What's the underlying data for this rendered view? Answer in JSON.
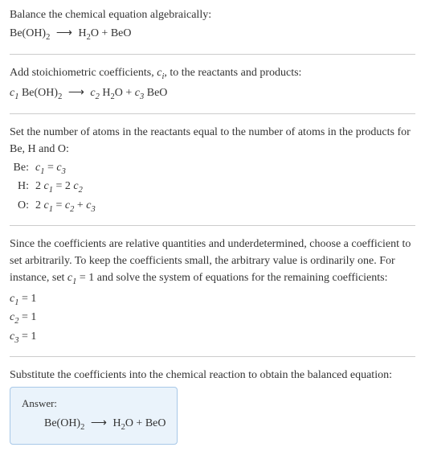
{
  "intro": {
    "line1": "Balance the chemical equation algebraically:",
    "reaction_lhs": "Be(OH)",
    "reaction_lhs_sub": "2",
    "arrow": "⟶",
    "reaction_rhs_1": "H",
    "reaction_rhs_1_sub": "2",
    "reaction_rhs_1_suffix": "O + BeO"
  },
  "stoich": {
    "text_before": "Add stoichiometric coefficients, ",
    "ci": "c",
    "ci_sub": "i",
    "text_after": ", to the reactants and products:",
    "c1": "c",
    "c1_sub": "1",
    "sp1": " Be(OH)",
    "sp1_sub": "2",
    "arrow": "⟶",
    "c2": "c",
    "c2_sub": "2",
    "sp2": " H",
    "sp2_sub": "2",
    "sp2_suffix": "O + ",
    "c3": "c",
    "c3_sub": "3",
    "sp3": " BeO"
  },
  "atoms": {
    "intro": "Set the number of atoms in the reactants equal to the number of atoms in the products for Be, H and O:",
    "rows": [
      {
        "label": "Be:",
        "lhs_coeff": "",
        "lhs_c": "c",
        "lhs_sub": "1",
        "eq": " = ",
        "rhs_coeff": "",
        "rhs_c": "c",
        "rhs_sub": "3",
        "tail": ""
      },
      {
        "label": "H:",
        "lhs_coeff": "2 ",
        "lhs_c": "c",
        "lhs_sub": "1",
        "eq": " = 2 ",
        "rhs_coeff": "",
        "rhs_c": "c",
        "rhs_sub": "2",
        "tail": ""
      },
      {
        "label": "O:",
        "lhs_coeff": "2 ",
        "lhs_c": "c",
        "lhs_sub": "1",
        "eq": " = ",
        "rhs_coeff": "",
        "rhs_c": "c",
        "rhs_sub": "2",
        "tail_plus": " + ",
        "tail_c": "c",
        "tail_sub": "3"
      }
    ]
  },
  "arbitrary": {
    "text_before": "Since the coefficients are relative quantities and underdetermined, choose a coefficient to set arbitrarily. To keep the coefficients small, the arbitrary value is ordinarily one. For instance, set ",
    "c": "c",
    "c_sub": "1",
    "text_after": " = 1 and solve the system of equations for the remaining coefficients:",
    "coeffs": [
      {
        "c": "c",
        "sub": "1",
        "val": " = 1"
      },
      {
        "c": "c",
        "sub": "2",
        "val": " = 1"
      },
      {
        "c": "c",
        "sub": "3",
        "val": " = 1"
      }
    ]
  },
  "final": {
    "text": "Substitute the coefficients into the chemical reaction to obtain the balanced equation:"
  },
  "answer": {
    "label": "Answer:",
    "lhs": "Be(OH)",
    "lhs_sub": "2",
    "arrow": "⟶",
    "rhs1": "H",
    "rhs1_sub": "2",
    "rhs_suffix": "O + BeO"
  }
}
